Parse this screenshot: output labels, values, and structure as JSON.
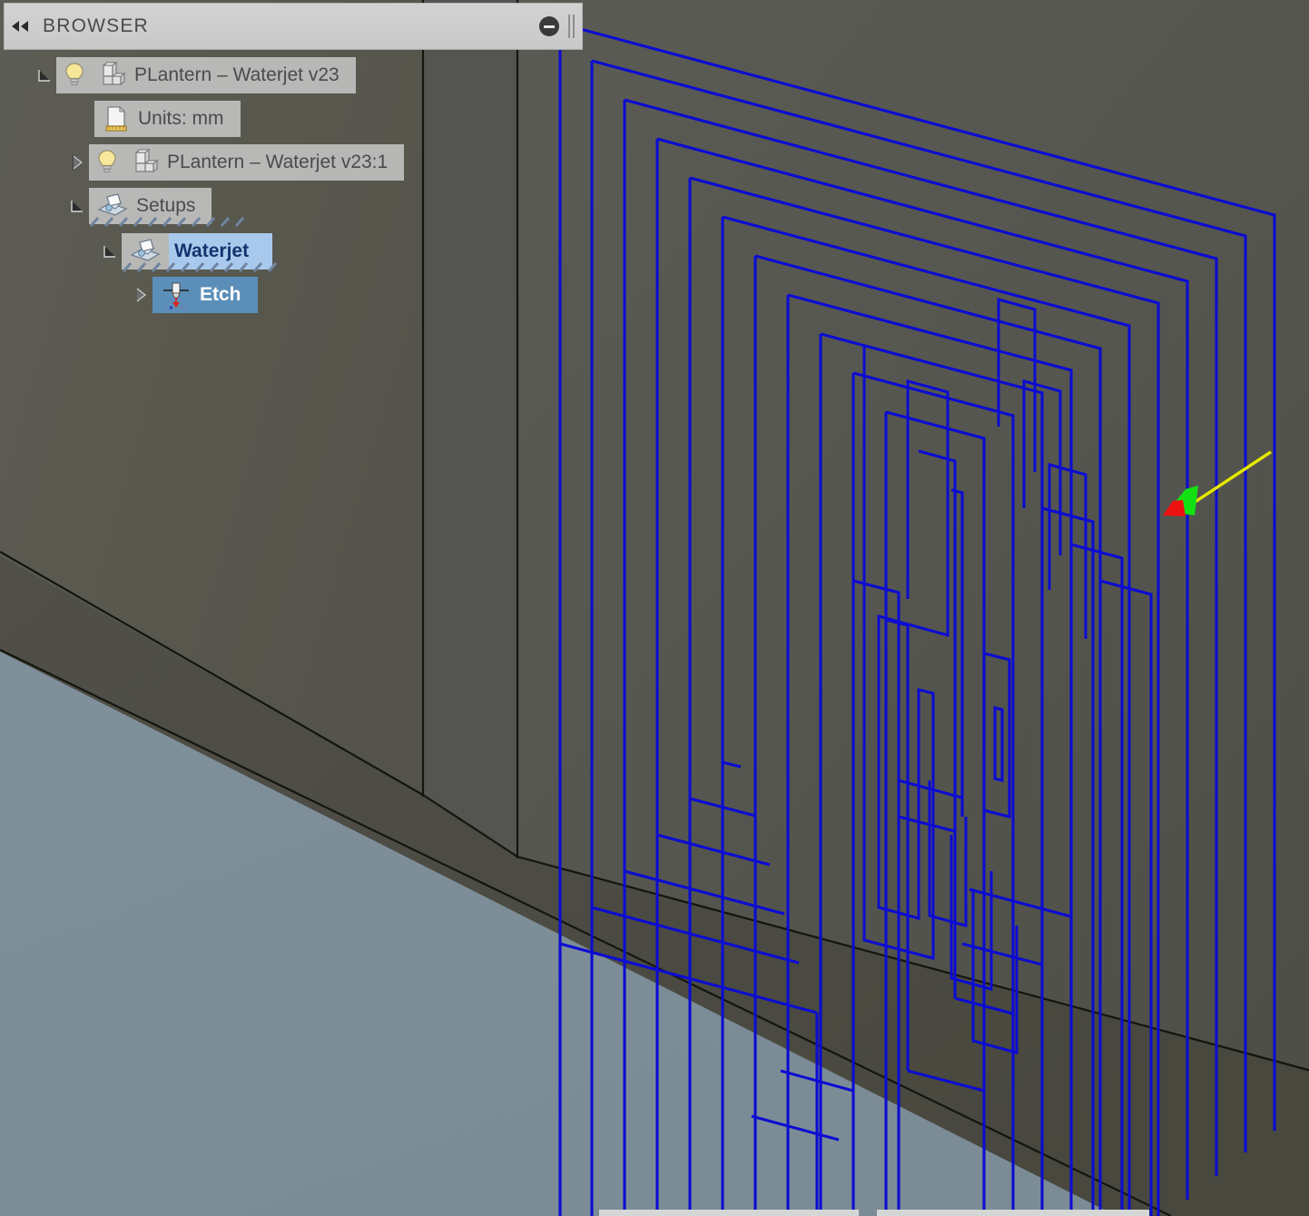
{
  "app": {
    "viewport_background": "#7e8f99",
    "model_color": "#575751",
    "toolpath_color": "#0c0cd2",
    "lead_in_color": "#e8e800",
    "lead_arrow_color": "#13e013",
    "start_point_color": "#ee1111"
  },
  "panel": {
    "title": "BROWSER",
    "collapse_icon": "double-chevron-left-icon",
    "minimize_icon": "minimize-icon",
    "resize_grip_icon": "resize-grip-icon",
    "header_bg": "#cdcdcd"
  },
  "tree": {
    "items": [
      {
        "id": "root-document",
        "label": "PLantern – Waterjet v23",
        "indent": 0,
        "twisty": "expanded",
        "icons": [
          "lightbulb-icon",
          "component-icon"
        ],
        "state": "normal"
      },
      {
        "id": "units",
        "label": "Units: mm",
        "indent": 1,
        "twisty": "none",
        "icons": [
          "document-ruler-icon"
        ],
        "state": "normal"
      },
      {
        "id": "component-occurrence",
        "label": "PLantern – Waterjet v23:1",
        "indent": 1,
        "twisty": "collapsed",
        "icons": [
          "lightbulb-icon",
          "component-icon"
        ],
        "state": "normal"
      },
      {
        "id": "setups-folder",
        "label": "Setups",
        "indent": 1,
        "twisty": "expanded",
        "icons": [
          "setup-folder-icon"
        ],
        "state": "normal"
      },
      {
        "id": "setup-waterjet",
        "label": "Waterjet",
        "indent": 2,
        "twisty": "expanded",
        "icons": [
          "setup-icon"
        ],
        "state": "selected-light"
      },
      {
        "id": "operation-etch",
        "label": "Etch",
        "indent": 3,
        "twisty": "collapsed",
        "icons": [
          "waterjet-tool-icon"
        ],
        "state": "selected-dark"
      }
    ]
  },
  "viewport": {
    "toolpath_name": "labyrinth-spiral-toolpath",
    "annotations": {
      "lead_in": "lead-in-line",
      "lead_in_arrow": "lead-in-direction-arrow",
      "start_point": "toolpath-start-point"
    }
  }
}
